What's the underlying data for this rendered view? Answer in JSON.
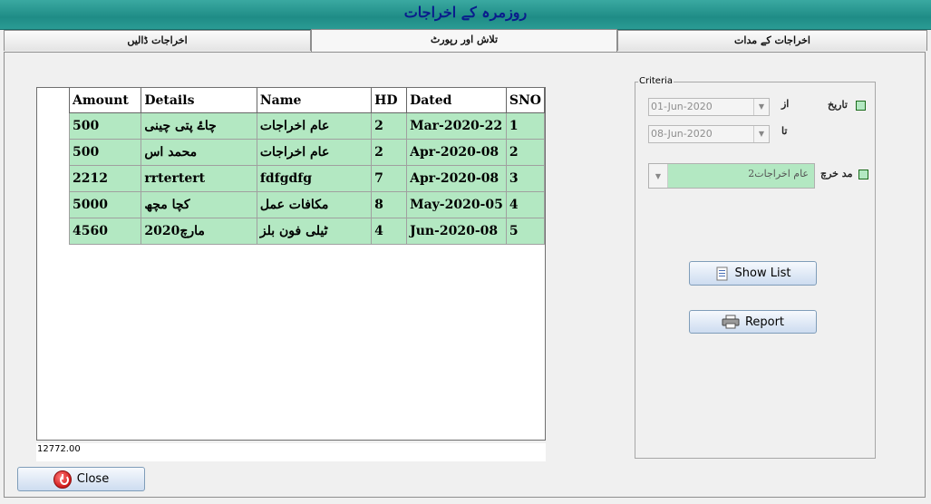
{
  "window": {
    "title": "روزمرہ کے اخراجات"
  },
  "tabs": [
    "اخراجات ڈالیں",
    "تلاش اور رپورٹ",
    "اخراجات کے مدات"
  ],
  "grid": {
    "headers": [
      "Amount",
      "Details",
      "Name",
      "HD",
      "Dated",
      "SNO"
    ],
    "rows": [
      [
        "500",
        "چاۓ پتی چینی",
        "عام اخراجات",
        "2",
        "Mar-2020-22",
        "1"
      ],
      [
        "500",
        "محمد اس",
        "عام اخراجات",
        "2",
        "Apr-2020-08",
        "2"
      ],
      [
        "2212",
        "rrtertert",
        "fdfgdfg",
        "7",
        "Apr-2020-08",
        "3"
      ],
      [
        "5000",
        "کچا مچھ",
        "مکافات عمل",
        "8",
        "May-2020-05",
        "4"
      ],
      [
        "4560",
        "مارچ2020",
        "ٹیلی فون بلز",
        "4",
        "Jun-2020-08",
        "5"
      ]
    ],
    "total": "12772.00"
  },
  "criteria": {
    "legend": "Criteria",
    "date_label": "تاریخ",
    "from_label": "از",
    "to_label": "تا",
    "from_date": "01-Jun-2020",
    "to_date": "08-Jun-2020",
    "category_label": "مد خرچ",
    "category_value": "2عام اخراجات"
  },
  "buttons": {
    "show_list": "Show List",
    "report": "Report",
    "close": "Close"
  },
  "colors": {
    "row_bg": "#b3e8c2",
    "title_bg": "#1f8c86",
    "title_text": "#0a1d8c"
  }
}
